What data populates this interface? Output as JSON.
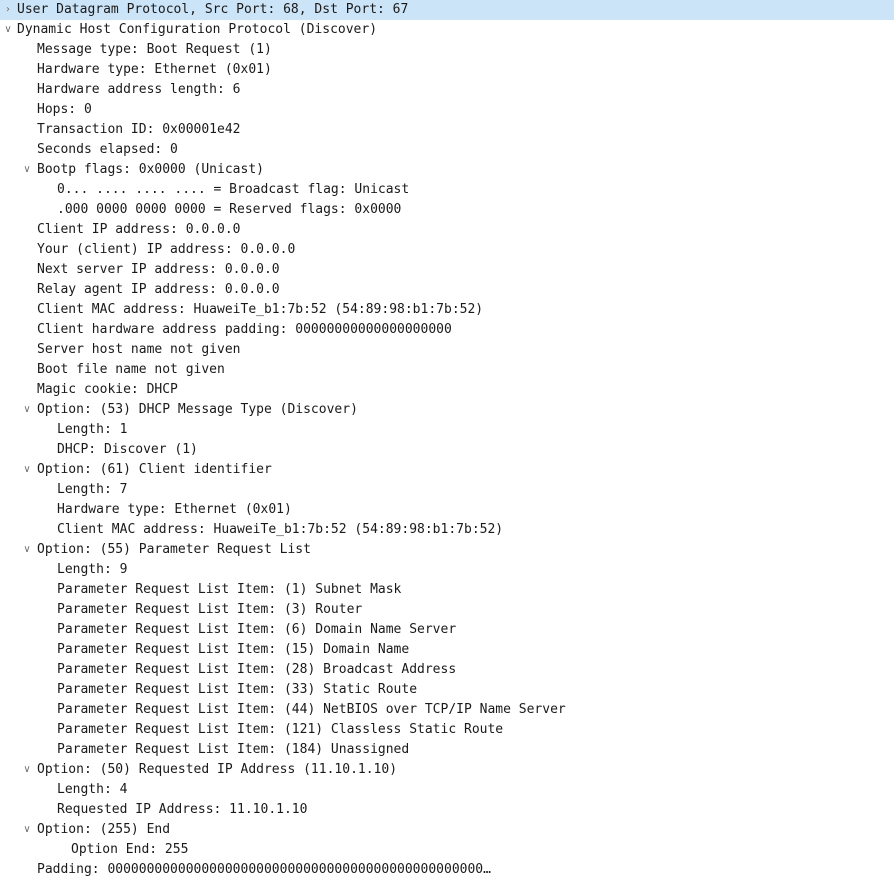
{
  "tree": [
    {
      "label": "User Datagram Protocol, Src Port: 68, Dst Port: 67",
      "level": 0,
      "toggle": "collapsed",
      "selected": true
    },
    {
      "label": "Dynamic Host Configuration Protocol (Discover)",
      "level": 0,
      "toggle": "expanded"
    },
    {
      "label": "Message type: Boot Request (1)",
      "level": 1
    },
    {
      "label": "Hardware type: Ethernet (0x01)",
      "level": 1
    },
    {
      "label": "Hardware address length: 6",
      "level": 1
    },
    {
      "label": "Hops: 0",
      "level": 1
    },
    {
      "label": "Transaction ID: 0x00001e42",
      "level": 1
    },
    {
      "label": "Seconds elapsed: 0",
      "level": 1
    },
    {
      "label": "Bootp flags: 0x0000 (Unicast)",
      "level": 1,
      "toggle": "expanded"
    },
    {
      "label": "0... .... .... .... = Broadcast flag: Unicast",
      "level": 2
    },
    {
      "label": ".000 0000 0000 0000 = Reserved flags: 0x0000",
      "level": 2
    },
    {
      "label": "Client IP address: 0.0.0.0",
      "level": 1
    },
    {
      "label": "Your (client) IP address: 0.0.0.0",
      "level": 1
    },
    {
      "label": "Next server IP address: 0.0.0.0",
      "level": 1
    },
    {
      "label": "Relay agent IP address: 0.0.0.0",
      "level": 1
    },
    {
      "label": "Client MAC address: HuaweiTe_b1:7b:52 (54:89:98:b1:7b:52)",
      "level": 1
    },
    {
      "label": "Client hardware address padding: 00000000000000000000",
      "level": 1
    },
    {
      "label": "Server host name not given",
      "level": 1
    },
    {
      "label": "Boot file name not given",
      "level": 1
    },
    {
      "label": "Magic cookie: DHCP",
      "level": 1
    },
    {
      "label": "Option: (53) DHCP Message Type (Discover)",
      "level": 1,
      "toggle": "expanded"
    },
    {
      "label": "Length: 1",
      "level": 2
    },
    {
      "label": "DHCP: Discover (1)",
      "level": 2
    },
    {
      "label": "Option: (61) Client identifier",
      "level": 1,
      "toggle": "expanded"
    },
    {
      "label": "Length: 7",
      "level": 2
    },
    {
      "label": "Hardware type: Ethernet (0x01)",
      "level": 2
    },
    {
      "label": "Client MAC address: HuaweiTe_b1:7b:52 (54:89:98:b1:7b:52)",
      "level": 2
    },
    {
      "label": "Option: (55) Parameter Request List",
      "level": 1,
      "toggle": "expanded"
    },
    {
      "label": "Length: 9",
      "level": 2
    },
    {
      "label": "Parameter Request List Item: (1) Subnet Mask",
      "level": 2
    },
    {
      "label": "Parameter Request List Item: (3) Router",
      "level": 2
    },
    {
      "label": "Parameter Request List Item: (6) Domain Name Server",
      "level": 2
    },
    {
      "label": "Parameter Request List Item: (15) Domain Name",
      "level": 2
    },
    {
      "label": "Parameter Request List Item: (28) Broadcast Address",
      "level": 2
    },
    {
      "label": "Parameter Request List Item: (33) Static Route",
      "level": 2
    },
    {
      "label": "Parameter Request List Item: (44) NetBIOS over TCP/IP Name Server",
      "level": 2
    },
    {
      "label": "Parameter Request List Item: (121) Classless Static Route",
      "level": 2
    },
    {
      "label": "Parameter Request List Item: (184) Unassigned",
      "level": 2
    },
    {
      "label": "Option: (50) Requested IP Address (11.10.1.10)",
      "level": 1,
      "toggle": "expanded"
    },
    {
      "label": "Length: 4",
      "level": 2
    },
    {
      "label": "Requested IP Address: 11.10.1.10",
      "level": 2
    },
    {
      "label": "Option: (255) End",
      "level": 1,
      "toggle": "expanded"
    },
    {
      "label": "Option End: 255",
      "level": 2,
      "offset": true
    },
    {
      "label": "Padding: 000000000000000000000000000000000000000000000000…",
      "level": 1
    }
  ],
  "icons": {
    "expanded": "chevron-down-icon",
    "collapsed": "chevron-right-icon"
  },
  "colors": {
    "selected_row": "#cce4f7",
    "text": "#1a1a1a",
    "toggle_arrow": "#6f6f6f"
  }
}
